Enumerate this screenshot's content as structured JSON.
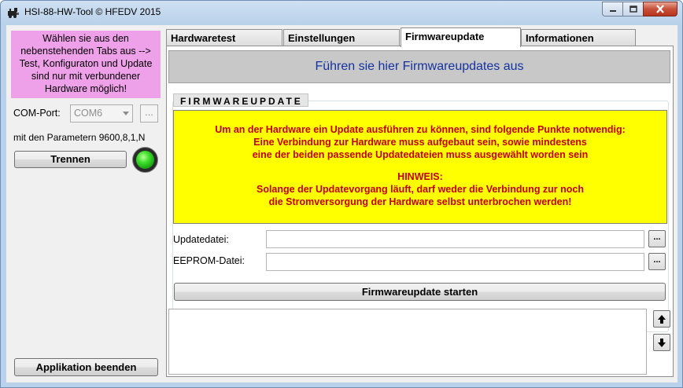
{
  "window": {
    "title": "HSI-88-HW-Tool © HFEDV 2015"
  },
  "left_panel": {
    "info_lines": [
      "Wählen sie aus den",
      "nebenstehenden Tabs aus -->",
      "Test, Konfiguraton und Update",
      "sind nur mit verbundener",
      "Hardware möglich!"
    ],
    "com_port_label": "COM-Port:",
    "com_port_value": "COM6",
    "com_browse_label": "...",
    "params_text": "mit den Parametern 9600,8,1,N",
    "disconnect_label": "Trennen",
    "connection_led_color": "#3fe02a",
    "exit_label": "Applikation beenden"
  },
  "tabs": [
    {
      "label": "Hardwaretest",
      "active": false
    },
    {
      "label": "Einstellungen",
      "active": false
    },
    {
      "label": "Firmwareupdate",
      "active": true
    },
    {
      "label": "Informationen",
      "active": false
    }
  ],
  "firmware": {
    "heading": "Führen sie hier Firmwareupdates aus",
    "group_title": "FIRMWAREUPDATE",
    "warning_lines": [
      "Um an der Hardware ein Update ausführen zu können, sind folgende Punkte notwendig:",
      "Eine Verbindung zur Hardware muss aufgebaut sein, sowie mindestens",
      "eine der beiden passende Updatedateien muss ausgewählt worden sein"
    ],
    "hint_lines": [
      "HINWEIS:",
      "Solange der Updatevorgang läuft, darf weder die Verbindung zur noch",
      "die Stromversorgung der Hardware selbst unterbrochen werden!"
    ],
    "update_file_label": "Updatedatei:",
    "update_file_value": "",
    "eeprom_file_label": "EEPROM-Datei:",
    "eeprom_file_value": "",
    "browse_label": "...",
    "start_label": "Firmwareupdate starten",
    "log_text": ""
  },
  "colors": {
    "info_background": "#eea0e8",
    "warning_background": "#ffff00",
    "warning_text": "#c00000",
    "heading_text": "#1533a0"
  },
  "icons": {
    "app": "locomotive-icon",
    "scroll_up": "arrow-up-icon",
    "scroll_down": "arrow-down-icon"
  }
}
